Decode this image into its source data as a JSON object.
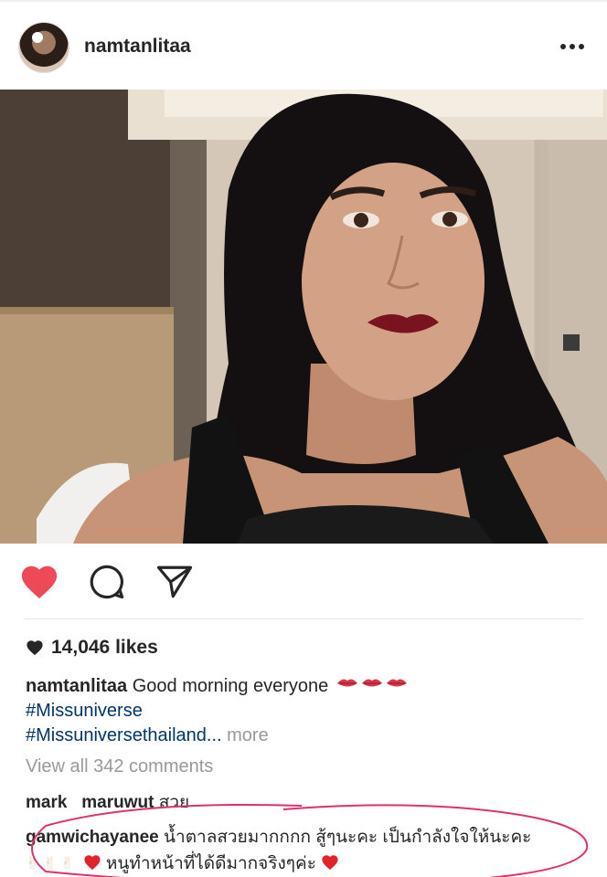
{
  "post": {
    "username": "namtanlitaa",
    "more_icon": "more-dots-icon",
    "photo_description_icon": "selfie-photo"
  },
  "actions": {
    "like_icon": "heart-filled-icon",
    "comment_icon": "comment-bubble-icon",
    "share_icon": "send-paper-plane-icon",
    "like_color": "#ed4956"
  },
  "likes": {
    "count_text": "14,046 likes"
  },
  "caption": {
    "username": "namtanlitaa",
    "text": "Good morning everyone",
    "tag1": "#Missuniverse",
    "tag2": "#Missuniversethailand...",
    "more_label": "more"
  },
  "comments": {
    "view_all": "View all 342 comments",
    "items": [
      {
        "user1": "mark",
        "user2": "maruwut",
        "text": "สวย"
      },
      {
        "user": "gamwichayanee",
        "text": "น้ำตาลสวยมากกกก สู้ๆนะคะ เป็นกำลังใจให้นะคะ",
        "text2": "หนูทำหน้าที่ได้ดีมากจริงๆค่ะ"
      }
    ]
  },
  "colors": {
    "link": "#003569",
    "muted": "#999999",
    "annotation": "#e0306e"
  }
}
